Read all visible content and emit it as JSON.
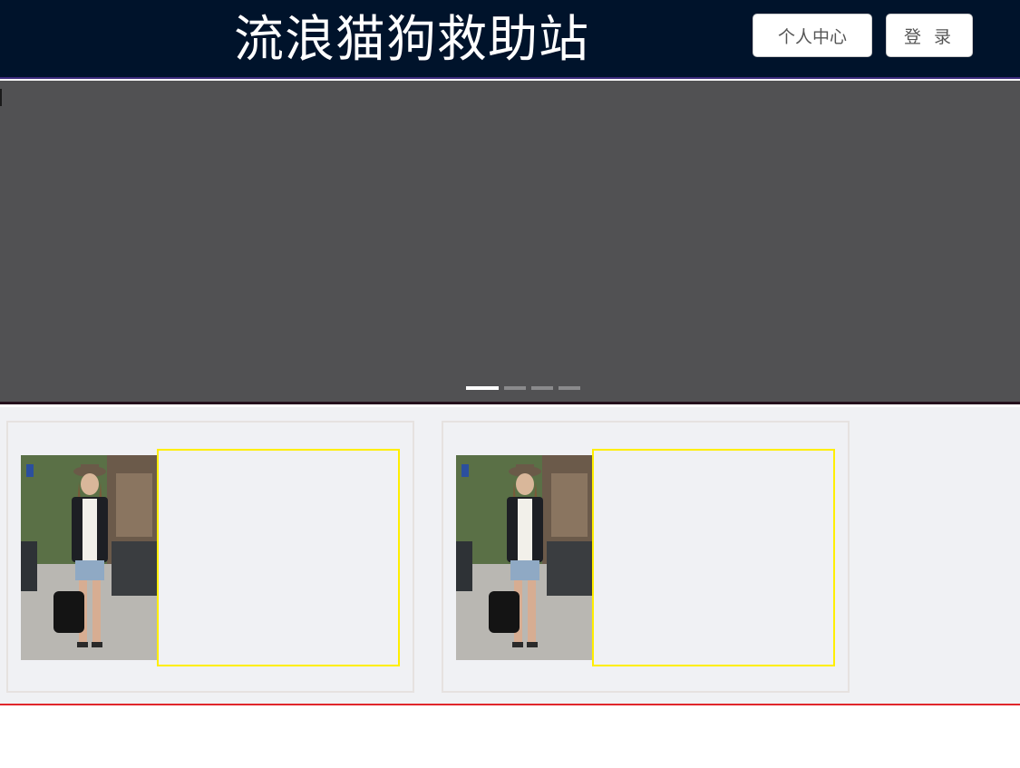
{
  "header": {
    "title": "流浪猫狗救助站",
    "personal_center_label": "个人中心",
    "login_label": "登 录"
  },
  "carousel": {
    "indicator_count": 4,
    "active_index": 0
  },
  "cards": [
    {
      "photo": "woman-street-photo"
    },
    {
      "photo": "woman-street-photo"
    }
  ],
  "colors": {
    "header_bg": "#00132b",
    "carousel_bg": "#515153",
    "content_bg": "#f0f1f4",
    "info_border": "#ffee00",
    "footer_line": "#e0262b"
  }
}
